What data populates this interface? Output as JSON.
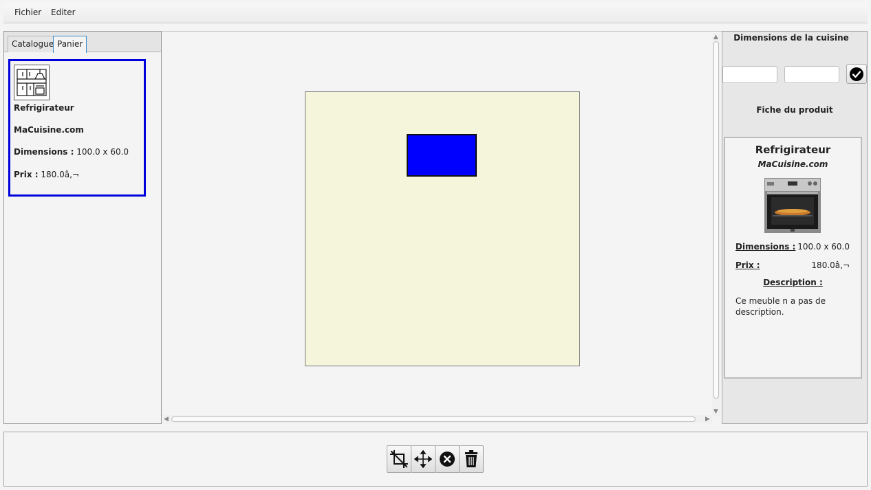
{
  "menu": {
    "file": "Fichier",
    "edit": "Editer"
  },
  "tabs": {
    "catalogue": "Catalogue",
    "cart": "Panier"
  },
  "card": {
    "name": "Refrigirateur",
    "brand": "MaCuisine.com",
    "dimensions_label": "Dimensions :",
    "dimensions_value": " 100.0 x 60.0",
    "price_label": "Prix :",
    "price_value": " 180.0â‚¬"
  },
  "right_panel": {
    "dimensions_title": "Dimensions de la cuisine",
    "width_value": "",
    "height_value": "",
    "sheet_title": "Fiche du produit"
  },
  "sheet": {
    "name": "Refrigirateur",
    "brand": "MaCuisine.com",
    "dimensions_label": "Dimensions :",
    "dimensions_value": "100.0 x 60.0",
    "price_label": "Prix :",
    "price_value": "180.0â‚¬",
    "description_label": "Description :",
    "description_text": "Ce meuble n a pas de description."
  },
  "icons": {
    "validate": "check-circle-icon",
    "crop": "crop-off-icon",
    "move": "move-arrows-icon",
    "cancel": "close-circle-icon",
    "delete": "trash-icon"
  },
  "colors": {
    "floor": "#f5f5dc",
    "furniture": "#0000ff",
    "selected_card_border": "#0000dd"
  }
}
